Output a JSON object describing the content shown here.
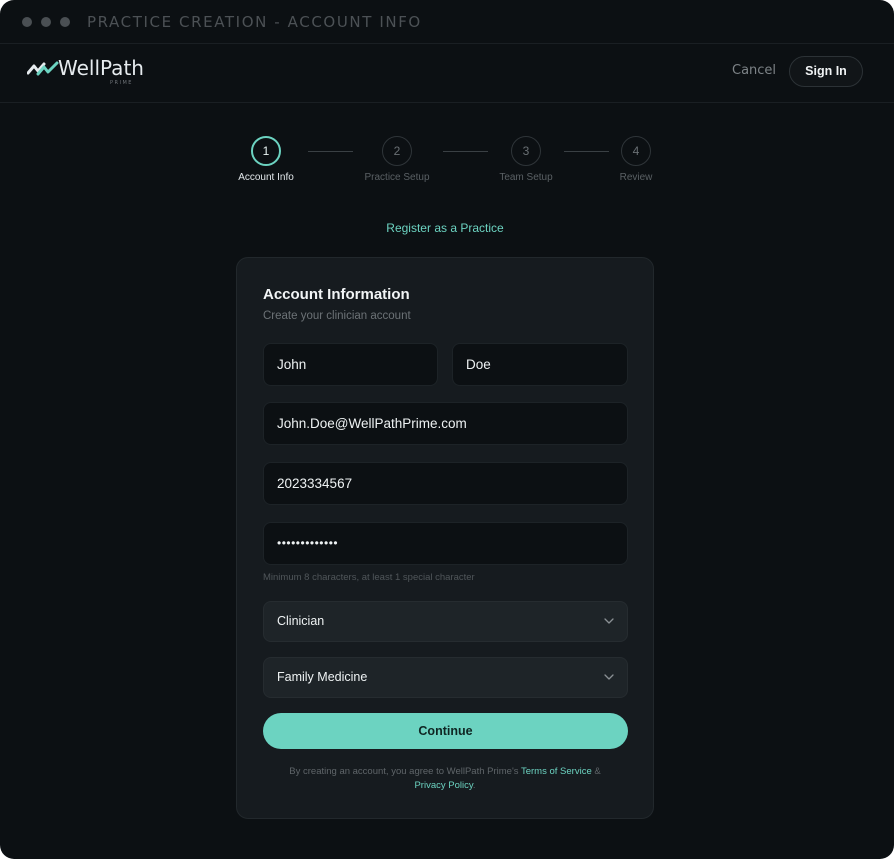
{
  "window": {
    "title": "PRACTICE CREATION - ACCOUNT INFO"
  },
  "brand": {
    "name": "WellPath",
    "sub": "PRIME",
    "accent": "#6cd3c1"
  },
  "header": {
    "cancel_label": "Cancel",
    "signin_label": "Sign In"
  },
  "stepper": {
    "steps": [
      {
        "number": "1",
        "label": "Account Info",
        "active": true
      },
      {
        "number": "2",
        "label": "Practice Setup",
        "active": false
      },
      {
        "number": "3",
        "label": "Team Setup",
        "active": false
      },
      {
        "number": "4",
        "label": "Review",
        "active": false
      }
    ]
  },
  "register_link": "Register as a Practice",
  "form": {
    "title": "Account Information",
    "subtitle": "Create your clinician account",
    "first_name": "John",
    "last_name": "Doe",
    "email": "John.Doe@WellPathPrime.com",
    "phone": "2023334567",
    "password_mask": "•••••••••••••",
    "password_hint": "Minimum 8 characters, at least 1 special character",
    "role_selected": "Clinician",
    "specialty_selected": "Family Medicine",
    "continue_label": "Continue",
    "legal_prefix": "By creating an account, you agree to WellPath Prime's",
    "terms_label": "Terms of Service",
    "legal_and": "&",
    "privacy_label": "Privacy Policy",
    "legal_suffix": "."
  }
}
